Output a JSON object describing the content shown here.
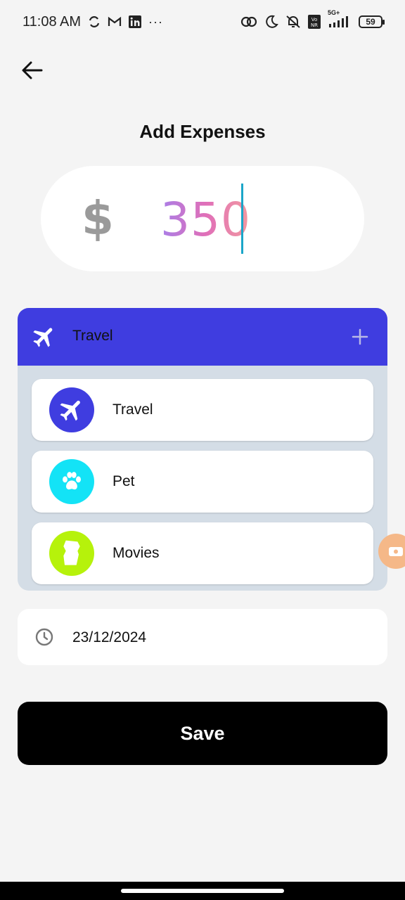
{
  "status_bar": {
    "time": "11:08 AM",
    "more": "···",
    "network": "5G+",
    "battery": "59"
  },
  "header": {
    "title": "Add Expenses"
  },
  "amount": {
    "currency": "$",
    "value": "350"
  },
  "category": {
    "selected_label": "Travel",
    "items": [
      {
        "label": "Travel",
        "icon": "airplane-icon",
        "color": "#3f3de0"
      },
      {
        "label": "Pet",
        "icon": "paw-icon",
        "color": "#13e3f6"
      },
      {
        "label": "Movies",
        "icon": "ticket-icon",
        "color": "#b6f20b"
      }
    ]
  },
  "date": {
    "value": "23/12/2024"
  },
  "actions": {
    "save_label": "Save"
  },
  "colors": {
    "header_bg": "#3f3de0",
    "panel_bg": "#d4dde6",
    "save_bg": "#000000"
  }
}
